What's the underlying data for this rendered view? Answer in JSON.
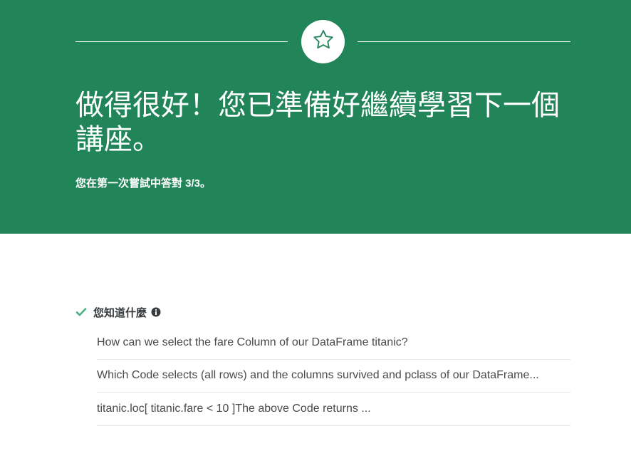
{
  "banner": {
    "headline": "做得很好！您已準備好繼續學習下一個講座。",
    "score_text": "您在第一次嘗試中答對 3/3。",
    "background_color": "#218559",
    "icon": "star-icon"
  },
  "section": {
    "title": "您知道什麼",
    "status_icon": "check-icon",
    "status_color": "#4caf7d",
    "info_icon": "info-icon",
    "questions": [
      "How can we select the fare Column of our DataFrame titanic?",
      "Which Code selects (all rows) and the columns survived and pclass of our DataFrame...",
      "titanic.loc[ titanic.fare < 10 ]The above Code returns ..."
    ]
  }
}
